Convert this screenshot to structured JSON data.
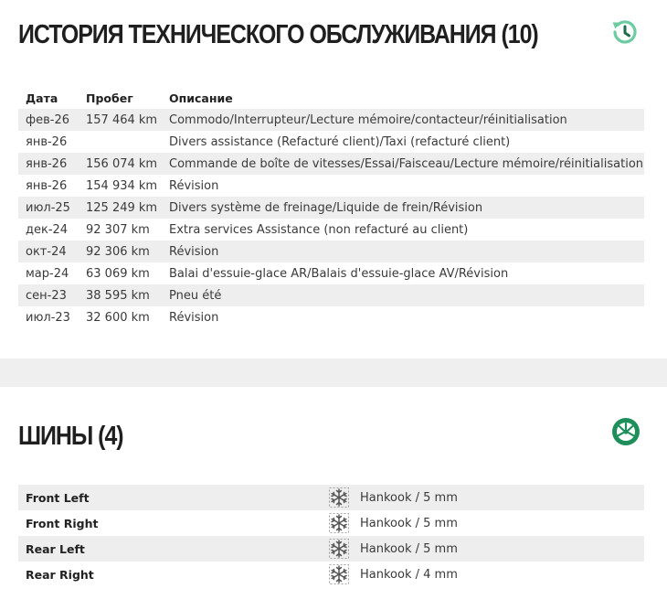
{
  "maintenance": {
    "title": "ИСТОРИЯ ТЕХНИЧЕСКОГО ОБСЛУЖИВАНИЯ (10)",
    "icon": "history-icon",
    "accent": "#6ccba0",
    "columns": {
      "date": "Дата",
      "km": "Пробег",
      "desc": "Описание"
    },
    "rows": [
      {
        "date": "фев-26",
        "km": "157 464 km",
        "desc": "Commodo/Interrupteur/Lecture mémoire/contacteur/réinitialisation"
      },
      {
        "date": "янв-26",
        "km": "",
        "desc": "Divers assistance (Refacturé client)/Taxi (refacturé client)"
      },
      {
        "date": "янв-26",
        "km": "156 074 km",
        "desc": "Commande de boîte de vitesses/Essai/Faisceau/Lecture mémoire/réinitialisation"
      },
      {
        "date": "янв-26",
        "km": "154 934 km",
        "desc": "Révision"
      },
      {
        "date": "июл-25",
        "km": "125 249 km",
        "desc": "Divers système de freinage/Liquide de frein/Révision"
      },
      {
        "date": "дек-24",
        "km": "92 307 km",
        "desc": "Extra services Assistance (non refacturé au client)"
      },
      {
        "date": "окт-24",
        "km": "92 306 km",
        "desc": "Révision"
      },
      {
        "date": "мар-24",
        "km": "63 069 km",
        "desc": "Balai d'essuie-glace AR/Balais d'essuie-glace AV/Révision"
      },
      {
        "date": "сен-23",
        "km": "38 595 km",
        "desc": "Pneu été"
      },
      {
        "date": "июл-23",
        "km": "32 600 km",
        "desc": "Révision"
      }
    ]
  },
  "tires": {
    "title": "ШИНЫ (4)",
    "icon": "tire-icon",
    "accent": "#1e8f5a",
    "rows": [
      {
        "position": "Front Left",
        "season_icon": "snowflake-icon",
        "value": "Hankook / 5 mm"
      },
      {
        "position": "Front Right",
        "season_icon": "snowflake-icon",
        "value": "Hankook / 5 mm"
      },
      {
        "position": "Rear Left",
        "season_icon": "snowflake-icon",
        "value": "Hankook / 5 mm"
      },
      {
        "position": "Rear Right",
        "season_icon": "snowflake-icon",
        "value": "Hankook / 4 mm"
      }
    ]
  }
}
